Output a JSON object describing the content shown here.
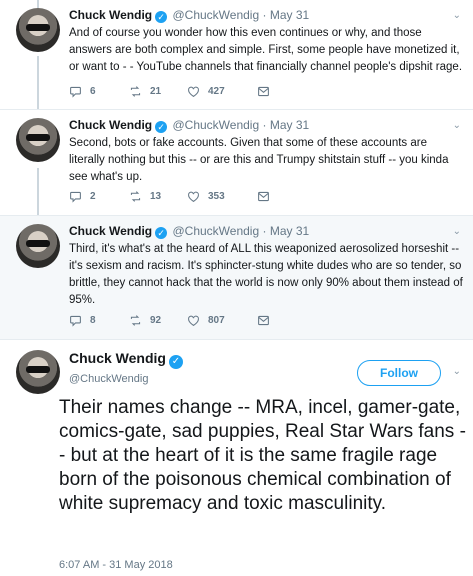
{
  "thread": [
    {
      "name": "Chuck Wendig",
      "handle": "@ChuckWendig",
      "dot": "·",
      "date": "May 31",
      "text": "And of course you wonder how this even continues or why, and those answers are both complex and simple. First, some people have monetized it, or want to - - YouTube channels that financially channel people's dipshit rage.",
      "replies": "6",
      "retweets": "21",
      "likes": "427"
    },
    {
      "name": "Chuck Wendig",
      "handle": "@ChuckWendig",
      "dot": "·",
      "date": "May 31",
      "text": "Second, bots or fake accounts. Given that some of these accounts are literally nothing but this -- or are this and Trumpy shitstain stuff -- you kinda see what's up.",
      "replies": "2",
      "retweets": "13",
      "likes": "353"
    },
    {
      "name": "Chuck Wendig",
      "handle": "@ChuckWendig",
      "dot": "·",
      "date": "May 31",
      "text": "Third, it's what's at the heard of ALL this weaponized aerosolized horseshit -- it's sexism and racism. It's sphincter-stung white dudes who are so tender, so brittle, they cannot hack that the world is now only 90% about them instead of 95%.",
      "replies": "8",
      "retweets": "92",
      "likes": "807"
    }
  ],
  "main": {
    "name": "Chuck Wendig",
    "handle": "@ChuckWendig",
    "follow_label": "Follow",
    "text": "Their names change -- MRA, incel, gamer-gate, comics-gate, sad puppies, Real Star Wars fans -- but at the heart of it is the same fragile rage born of the poisonous chemical combination of white supremacy and toxic masculinity.",
    "timestamp": "6:07 AM - 31 May 2018"
  },
  "icons": {
    "verified": "verified-badge-icon",
    "reply": "reply-icon",
    "retweet": "retweet-icon",
    "like": "heart-icon",
    "dm": "direct-message-icon",
    "more": "chevron-down-icon"
  },
  "colors": {
    "accent": "#1da1f2",
    "muted": "#657786",
    "text": "#14171a",
    "highlight_bg": "#f5f8fa"
  }
}
